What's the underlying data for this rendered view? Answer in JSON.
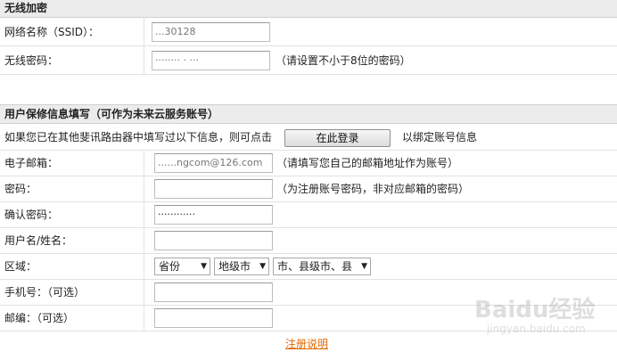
{
  "wireless": {
    "title": "无线加密",
    "ssid_label": "网络名称（SSID）：",
    "ssid_value": "...30128",
    "password_label": "无线密码：",
    "password_value": "········  ·  ···",
    "password_hint": "（请设置不小于8位的密码）"
  },
  "account": {
    "title": "用户保修信息填写（可作为未来云服务账号）",
    "notice_text": "如果您已在其他斐讯路由器中填写过以下信息，则可点击",
    "login_button": "在此登录",
    "notice_suffix": "以绑定账号信息",
    "email_label": "电子邮箱：",
    "email_value": "......ngcom@126.com",
    "email_hint": "（请填写您自己的邮箱地址作为账号）",
    "password_label": "密码：",
    "password_value": "",
    "password_hint": "（为注册账号密码，非对应邮箱的密码）",
    "confirm_label": "确认密码：",
    "confirm_value": "············",
    "username_label": "用户名/姓名：",
    "region_label": "区域：",
    "region_province": "省份",
    "region_city": "地级市",
    "region_county": "市、县级市、县",
    "phone_label": "手机号：（可选）",
    "zip_label": "邮编：（可选）",
    "register_link": "注册说明"
  },
  "watermark": {
    "brand": "Baidu经验",
    "url": "jingyan.baidu.com"
  }
}
